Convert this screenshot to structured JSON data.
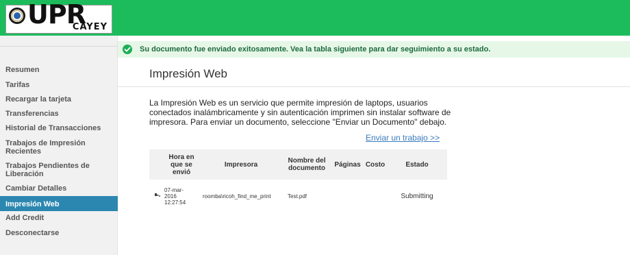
{
  "logo": {
    "upr": "UPR",
    "cayey": "CAYEY"
  },
  "banner": {
    "message": "Su documento fue enviado exitosamente. Vea la tabla siguiente para dar seguimiento a su estado."
  },
  "sidebar": {
    "items": [
      {
        "label": "Resumen"
      },
      {
        "label": "Tarifas"
      },
      {
        "label": "Recargar la tarjeta"
      },
      {
        "label": "Transferencias"
      },
      {
        "label": "Historial de Transacciones"
      },
      {
        "label_line1": "Trabajos de Impresión",
        "label_line2": "Recientes"
      },
      {
        "label_line1": "Trabajos Pendientes de",
        "label_line2": "Liberación"
      },
      {
        "label": "Cambiar Detalles"
      },
      {
        "label": "Impresión Web",
        "active": true
      },
      {
        "label": "Add Credit"
      },
      {
        "label": "Desconectarse"
      }
    ]
  },
  "main": {
    "title": "Impresión Web",
    "intro": "La Impresión Web es un servicio que permite impresión de laptops, usuarios conectados inalámbricamente y sin autenticación imprimen sin instalar software de impresora. Para enviar un documento, seleccione \"Enviar un Documento\" debajo.",
    "send_link": "Enviar un trabajo >>",
    "table": {
      "headers": {
        "time_line1": "Hora en",
        "time_line2": "que se",
        "time_line3": "envió",
        "printer": "Impresora",
        "doc_line1": "Nombre del",
        "doc_line2": "documento",
        "pages": "Páginas",
        "cost": "Costo",
        "status": "Estado"
      },
      "rows": [
        {
          "date_line1": "07-mar-",
          "date_line2": "2016",
          "date_line3": "12:27:54",
          "printer": "roomba\\ricoh_find_me_print",
          "document": "Test.pdf",
          "pages": "",
          "cost": "",
          "status": "Submitting"
        }
      ]
    }
  },
  "colors": {
    "header_green": "#1cbc5c",
    "active_blue": "#2c87b0",
    "link_blue": "#3a7bbf",
    "banner_bg": "#e6f7e8"
  },
  "icons": {
    "status_check": "check-circle-icon",
    "printer": "printer-icon",
    "seal": "university-seal-icon"
  }
}
